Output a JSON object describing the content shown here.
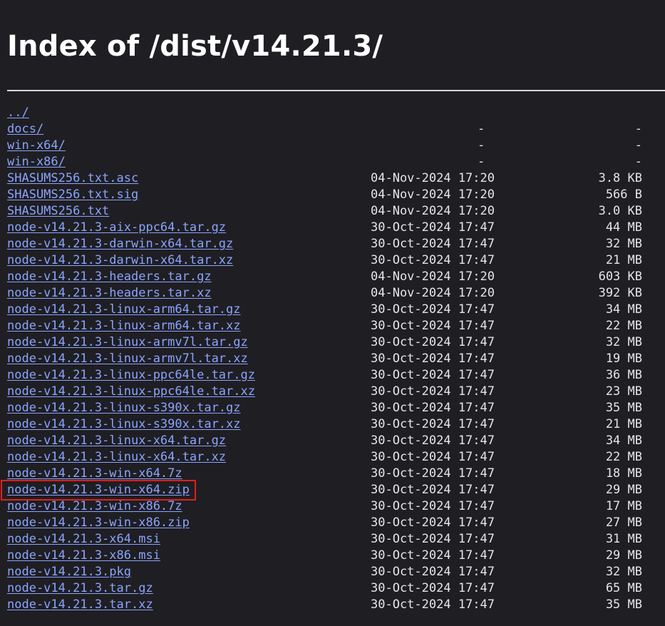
{
  "title": "Index of /dist/v14.21.3/",
  "highlight_color": "#e02020",
  "link_color": "#8aa4ff",
  "entries": [
    {
      "name": "../",
      "date": "",
      "size": ""
    },
    {
      "name": "docs/",
      "date": "-",
      "size": "-"
    },
    {
      "name": "win-x64/",
      "date": "-",
      "size": "-"
    },
    {
      "name": "win-x86/",
      "date": "-",
      "size": "-"
    },
    {
      "name": "SHASUMS256.txt.asc",
      "date": "04-Nov-2024 17:20",
      "size": "3.8 KB"
    },
    {
      "name": "SHASUMS256.txt.sig",
      "date": "04-Nov-2024 17:20",
      "size": "566 B"
    },
    {
      "name": "SHASUMS256.txt",
      "date": "04-Nov-2024 17:20",
      "size": "3.0 KB"
    },
    {
      "name": "node-v14.21.3-aix-ppc64.tar.gz",
      "date": "30-Oct-2024 17:47",
      "size": "44 MB"
    },
    {
      "name": "node-v14.21.3-darwin-x64.tar.gz",
      "date": "30-Oct-2024 17:47",
      "size": "32 MB"
    },
    {
      "name": "node-v14.21.3-darwin-x64.tar.xz",
      "date": "30-Oct-2024 17:47",
      "size": "21 MB"
    },
    {
      "name": "node-v14.21.3-headers.tar.gz",
      "date": "04-Nov-2024 17:20",
      "size": "603 KB"
    },
    {
      "name": "node-v14.21.3-headers.tar.xz",
      "date": "04-Nov-2024 17:20",
      "size": "392 KB"
    },
    {
      "name": "node-v14.21.3-linux-arm64.tar.gz",
      "date": "30-Oct-2024 17:47",
      "size": "34 MB"
    },
    {
      "name": "node-v14.21.3-linux-arm64.tar.xz",
      "date": "30-Oct-2024 17:47",
      "size": "22 MB"
    },
    {
      "name": "node-v14.21.3-linux-armv7l.tar.gz",
      "date": "30-Oct-2024 17:47",
      "size": "32 MB"
    },
    {
      "name": "node-v14.21.3-linux-armv7l.tar.xz",
      "date": "30-Oct-2024 17:47",
      "size": "19 MB"
    },
    {
      "name": "node-v14.21.3-linux-ppc64le.tar.gz",
      "date": "30-Oct-2024 17:47",
      "size": "36 MB"
    },
    {
      "name": "node-v14.21.3-linux-ppc64le.tar.xz",
      "date": "30-Oct-2024 17:47",
      "size": "23 MB"
    },
    {
      "name": "node-v14.21.3-linux-s390x.tar.gz",
      "date": "30-Oct-2024 17:47",
      "size": "35 MB"
    },
    {
      "name": "node-v14.21.3-linux-s390x.tar.xz",
      "date": "30-Oct-2024 17:47",
      "size": "21 MB"
    },
    {
      "name": "node-v14.21.3-linux-x64.tar.gz",
      "date": "30-Oct-2024 17:47",
      "size": "34 MB"
    },
    {
      "name": "node-v14.21.3-linux-x64.tar.xz",
      "date": "30-Oct-2024 17:47",
      "size": "22 MB"
    },
    {
      "name": "node-v14.21.3-win-x64.7z",
      "date": "30-Oct-2024 17:47",
      "size": "18 MB"
    },
    {
      "name": "node-v14.21.3-win-x64.zip",
      "date": "30-Oct-2024 17:47",
      "size": "29 MB",
      "highlighted": true
    },
    {
      "name": "node-v14.21.3-win-x86.7z",
      "date": "30-Oct-2024 17:47",
      "size": "17 MB"
    },
    {
      "name": "node-v14.21.3-win-x86.zip",
      "date": "30-Oct-2024 17:47",
      "size": "27 MB"
    },
    {
      "name": "node-v14.21.3-x64.msi",
      "date": "30-Oct-2024 17:47",
      "size": "31 MB"
    },
    {
      "name": "node-v14.21.3-x86.msi",
      "date": "30-Oct-2024 17:47",
      "size": "29 MB"
    },
    {
      "name": "node-v14.21.3.pkg",
      "date": "30-Oct-2024 17:47",
      "size": "32 MB"
    },
    {
      "name": "node-v14.21.3.tar.gz",
      "date": "30-Oct-2024 17:47",
      "size": "65 MB"
    },
    {
      "name": "node-v14.21.3.tar.xz",
      "date": "30-Oct-2024 17:47",
      "size": "35 MB"
    }
  ]
}
